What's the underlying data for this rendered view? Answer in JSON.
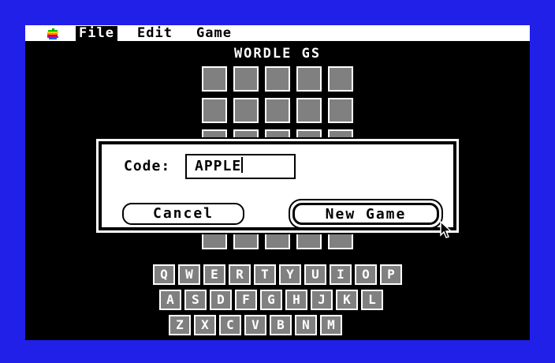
{
  "menubar": {
    "apple_icon": "apple-icon",
    "items": [
      {
        "label": "File",
        "active": true
      },
      {
        "label": "Edit",
        "active": false
      },
      {
        "label": "Game",
        "active": false
      }
    ]
  },
  "title": "WORDLE GS",
  "board": {
    "rows": 6,
    "cols": 5
  },
  "keyboard": {
    "row1": [
      "Q",
      "W",
      "E",
      "R",
      "T",
      "Y",
      "U",
      "I",
      "O",
      "P"
    ],
    "row2": [
      "A",
      "S",
      "D",
      "F",
      "G",
      "H",
      "J",
      "K",
      "L"
    ],
    "row3": [
      "Z",
      "X",
      "C",
      "V",
      "B",
      "N",
      "M"
    ]
  },
  "dialog": {
    "code_label": "Code:",
    "code_value": "APPLE",
    "cancel_label": "Cancel",
    "new_game_label": "New Game"
  },
  "colors": {
    "border": "#2020e8",
    "screen": "#000000",
    "tile": "#808080"
  }
}
